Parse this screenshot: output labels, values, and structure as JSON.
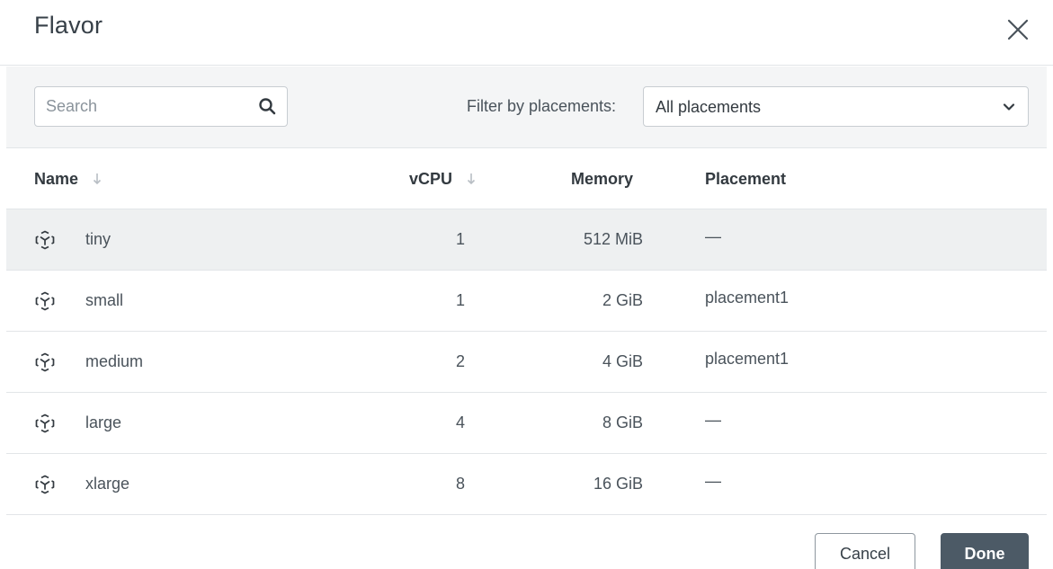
{
  "dialog": {
    "title": "Flavor"
  },
  "toolbar": {
    "search_placeholder": "Search",
    "filter_label": "Filter by placements:",
    "filter_value": "All placements"
  },
  "table": {
    "columns": [
      "Name",
      "vCPU",
      "Memory",
      "Placement"
    ],
    "rows": [
      {
        "name": "tiny",
        "vcpu": "1",
        "memory": "512 MiB",
        "placement": "—",
        "selected": true
      },
      {
        "name": "small",
        "vcpu": "1",
        "memory": "2 GiB",
        "placement": "placement1",
        "selected": false
      },
      {
        "name": "medium",
        "vcpu": "2",
        "memory": "4 GiB",
        "placement": "placement1",
        "selected": false
      },
      {
        "name": "large",
        "vcpu": "4",
        "memory": "8 GiB",
        "placement": "—",
        "selected": false
      },
      {
        "name": "xlarge",
        "vcpu": "8",
        "memory": "16 GiB",
        "placement": "—",
        "selected": false
      }
    ]
  },
  "footer": {
    "cancel_label": "Cancel",
    "done_label": "Done"
  },
  "icons": {
    "close": "close-icon",
    "search": "search-icon",
    "dropdown": "chevron-down-icon",
    "sort": "arrow-down-icon",
    "flavor": "flavor-cube-icon"
  },
  "colors": {
    "primary_button": "#4c5a66",
    "selected_row": "#eef0f1",
    "toolbar_bg": "#f4f5f6"
  }
}
